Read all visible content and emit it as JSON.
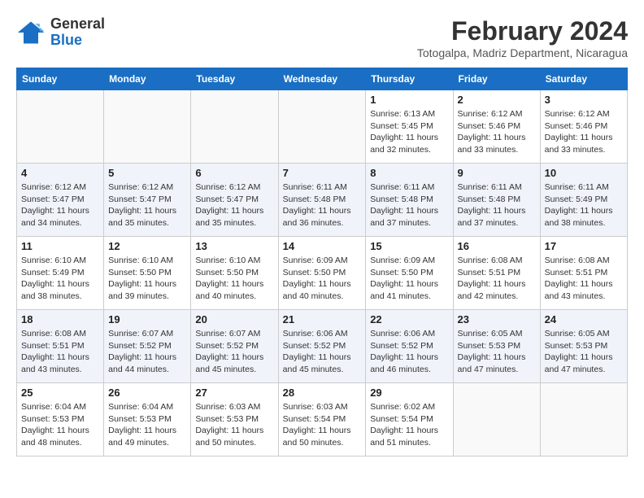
{
  "logo": {
    "general": "General",
    "blue": "Blue"
  },
  "title": "February 2024",
  "location": "Totogalpa, Madriz Department, Nicaragua",
  "days_of_week": [
    "Sunday",
    "Monday",
    "Tuesday",
    "Wednesday",
    "Thursday",
    "Friday",
    "Saturday"
  ],
  "weeks": [
    [
      {
        "day": "",
        "info": ""
      },
      {
        "day": "",
        "info": ""
      },
      {
        "day": "",
        "info": ""
      },
      {
        "day": "",
        "info": ""
      },
      {
        "day": "1",
        "sunrise": "6:13 AM",
        "sunset": "5:45 PM",
        "daylight": "11 hours and 32 minutes."
      },
      {
        "day": "2",
        "sunrise": "6:12 AM",
        "sunset": "5:46 PM",
        "daylight": "11 hours and 33 minutes."
      },
      {
        "day": "3",
        "sunrise": "6:12 AM",
        "sunset": "5:46 PM",
        "daylight": "11 hours and 33 minutes."
      }
    ],
    [
      {
        "day": "4",
        "sunrise": "6:12 AM",
        "sunset": "5:47 PM",
        "daylight": "11 hours and 34 minutes."
      },
      {
        "day": "5",
        "sunrise": "6:12 AM",
        "sunset": "5:47 PM",
        "daylight": "11 hours and 35 minutes."
      },
      {
        "day": "6",
        "sunrise": "6:12 AM",
        "sunset": "5:47 PM",
        "daylight": "11 hours and 35 minutes."
      },
      {
        "day": "7",
        "sunrise": "6:11 AM",
        "sunset": "5:48 PM",
        "daylight": "11 hours and 36 minutes."
      },
      {
        "day": "8",
        "sunrise": "6:11 AM",
        "sunset": "5:48 PM",
        "daylight": "11 hours and 37 minutes."
      },
      {
        "day": "9",
        "sunrise": "6:11 AM",
        "sunset": "5:48 PM",
        "daylight": "11 hours and 37 minutes."
      },
      {
        "day": "10",
        "sunrise": "6:11 AM",
        "sunset": "5:49 PM",
        "daylight": "11 hours and 38 minutes."
      }
    ],
    [
      {
        "day": "11",
        "sunrise": "6:10 AM",
        "sunset": "5:49 PM",
        "daylight": "11 hours and 38 minutes."
      },
      {
        "day": "12",
        "sunrise": "6:10 AM",
        "sunset": "5:50 PM",
        "daylight": "11 hours and 39 minutes."
      },
      {
        "day": "13",
        "sunrise": "6:10 AM",
        "sunset": "5:50 PM",
        "daylight": "11 hours and 40 minutes."
      },
      {
        "day": "14",
        "sunrise": "6:09 AM",
        "sunset": "5:50 PM",
        "daylight": "11 hours and 40 minutes."
      },
      {
        "day": "15",
        "sunrise": "6:09 AM",
        "sunset": "5:50 PM",
        "daylight": "11 hours and 41 minutes."
      },
      {
        "day": "16",
        "sunrise": "6:08 AM",
        "sunset": "5:51 PM",
        "daylight": "11 hours and 42 minutes."
      },
      {
        "day": "17",
        "sunrise": "6:08 AM",
        "sunset": "5:51 PM",
        "daylight": "11 hours and 43 minutes."
      }
    ],
    [
      {
        "day": "18",
        "sunrise": "6:08 AM",
        "sunset": "5:51 PM",
        "daylight": "11 hours and 43 minutes."
      },
      {
        "day": "19",
        "sunrise": "6:07 AM",
        "sunset": "5:52 PM",
        "daylight": "11 hours and 44 minutes."
      },
      {
        "day": "20",
        "sunrise": "6:07 AM",
        "sunset": "5:52 PM",
        "daylight": "11 hours and 45 minutes."
      },
      {
        "day": "21",
        "sunrise": "6:06 AM",
        "sunset": "5:52 PM",
        "daylight": "11 hours and 45 minutes."
      },
      {
        "day": "22",
        "sunrise": "6:06 AM",
        "sunset": "5:52 PM",
        "daylight": "11 hours and 46 minutes."
      },
      {
        "day": "23",
        "sunrise": "6:05 AM",
        "sunset": "5:53 PM",
        "daylight": "11 hours and 47 minutes."
      },
      {
        "day": "24",
        "sunrise": "6:05 AM",
        "sunset": "5:53 PM",
        "daylight": "11 hours and 47 minutes."
      }
    ],
    [
      {
        "day": "25",
        "sunrise": "6:04 AM",
        "sunset": "5:53 PM",
        "daylight": "11 hours and 48 minutes."
      },
      {
        "day": "26",
        "sunrise": "6:04 AM",
        "sunset": "5:53 PM",
        "daylight": "11 hours and 49 minutes."
      },
      {
        "day": "27",
        "sunrise": "6:03 AM",
        "sunset": "5:53 PM",
        "daylight": "11 hours and 50 minutes."
      },
      {
        "day": "28",
        "sunrise": "6:03 AM",
        "sunset": "5:54 PM",
        "daylight": "11 hours and 50 minutes."
      },
      {
        "day": "29",
        "sunrise": "6:02 AM",
        "sunset": "5:54 PM",
        "daylight": "11 hours and 51 minutes."
      },
      {
        "day": "",
        "info": ""
      },
      {
        "day": "",
        "info": ""
      }
    ]
  ]
}
